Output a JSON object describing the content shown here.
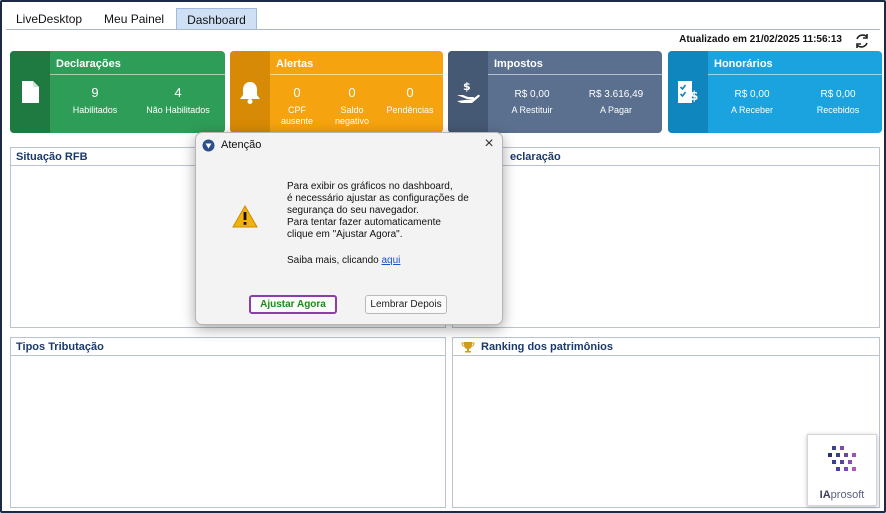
{
  "tabs": [
    {
      "label": "LiveDesktop",
      "active": false
    },
    {
      "label": "Meu Painel",
      "active": false
    },
    {
      "label": "Dashboard",
      "active": true
    }
  ],
  "updated_text": "Atualizado em 21/02/2025 11:56:13",
  "cards": {
    "declaracoes": {
      "title": "Declarações",
      "color": "#2e9d57",
      "dark": "#1f7a41",
      "m1_value": "9",
      "m1_label": "Habilitados",
      "m2_value": "4",
      "m2_label": "Não Habilitados"
    },
    "alertas": {
      "title": "Alertas",
      "color": "#f5a30e",
      "dark": "#d78a05",
      "m1_value": "0",
      "m1_label_a": "CPF",
      "m1_label_b": "ausente",
      "m2_value": "0",
      "m2_label_a": "Saldo",
      "m2_label_b": "negativo",
      "m3_value": "0",
      "m3_label": "Pendências"
    },
    "impostos": {
      "title": "Impostos",
      "color": "#5b6f8f",
      "dark": "#455874",
      "m1_value": "R$ 0,00",
      "m1_label": "A Restituir",
      "m2_value": "R$ 3.616,49",
      "m2_label": "A Pagar"
    },
    "honorarios": {
      "title": "Honorários",
      "color": "#1aa3de",
      "dark": "#0f86bd",
      "m1_value": "R$ 0,00",
      "m1_label": "A Receber",
      "m2_value": "R$ 0,00",
      "m2_label": "Recebidos"
    }
  },
  "panels": {
    "situacao": "Situação RFB",
    "declaracao_partial": "eclaração",
    "tipos": "Tipos Tributação",
    "ranking": "Ranking dos patrimônios"
  },
  "dialog": {
    "title": "Atenção",
    "line1": "Para exibir os gráficos no dashboard,",
    "line2": "é necessário ajustar as configurações de",
    "line3": "segurança do seu navegador.",
    "line4": "Para tentar fazer automaticamente",
    "line5": "clique em \"Ajustar Agora\".",
    "saiba_mais": "Saiba mais, clicando ",
    "link": "aqui",
    "primary_button": "Ajustar Agora",
    "secondary_button": "Lembrar Depois"
  },
  "logo": {
    "text_a": "IA",
    "text_b": "prosoft"
  },
  "colors": {
    "accent": "#1b3a6b",
    "highlight_border": "#8b3fa6",
    "primary_text": "#1e8a1e"
  }
}
